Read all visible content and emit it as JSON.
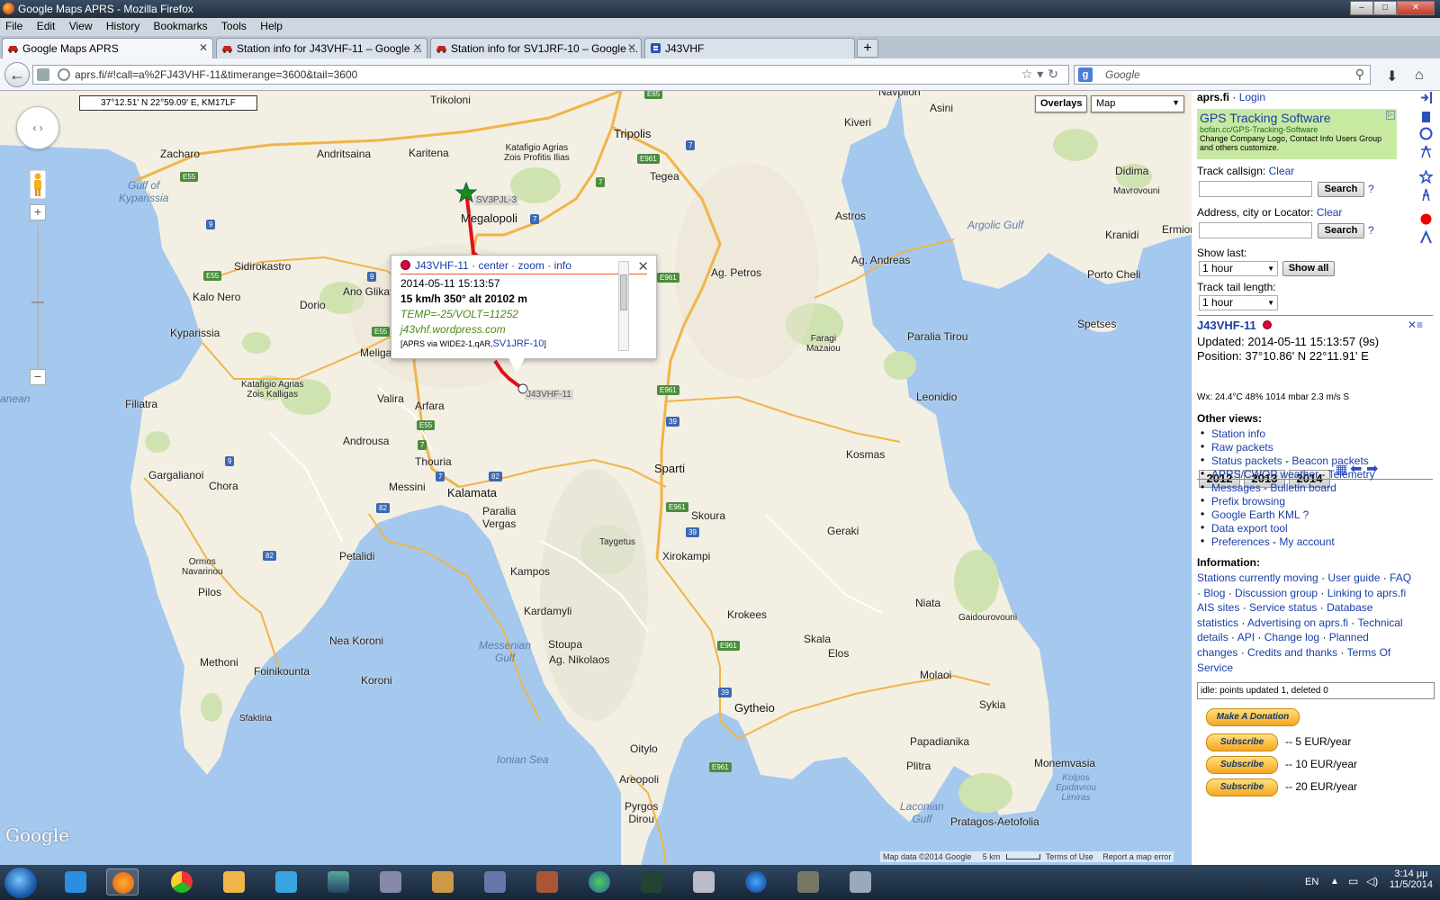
{
  "window": {
    "title": "Google Maps APRS - Mozilla Firefox",
    "buttons": {
      "minimize": "–",
      "maximize": "□",
      "close": "✕"
    }
  },
  "menu": [
    "File",
    "Edit",
    "View",
    "History",
    "Bookmarks",
    "Tools",
    "Help"
  ],
  "tabs": [
    {
      "label": "Google Maps APRS",
      "icon": "car-icon",
      "active": true
    },
    {
      "label": "Station info for J43VHF-11 – Google ...",
      "icon": "car-icon",
      "active": false
    },
    {
      "label": "Station info for SV1JRF-10 – Google ...",
      "icon": "car-icon",
      "active": false
    },
    {
      "label": "J43VHF",
      "icon": "blogger-icon",
      "active": false
    }
  ],
  "nav": {
    "url": "aprs.fi/#!call=a%2FJ43VHF-11&timerange=3600&tail=3600",
    "search_placeholder": "Google"
  },
  "map": {
    "coord_readout": "37°12.51' N 22°59.09' E, KM17LF",
    "overlays_label": "Overlays",
    "maptype_label": "Map",
    "google_logo": "Google",
    "attribution": "Map data ©2014 Google",
    "scale_label": "5 km",
    "terms_label": "Terms of Use",
    "report_label": "Report a map error",
    "zoom_in": "+",
    "zoom_out": "−",
    "labels": {
      "trikoloni": "Trikoloni",
      "tripolis": "Tripolis",
      "kiveri": "Kiveri",
      "astros": "Astros",
      "zacharo": "Zacharo",
      "andritsaina": "Andritsaina",
      "karitena": "Karitena",
      "megalopoli": "Megalopoli",
      "tegea": "Tegea",
      "gulf_kyparissia": "Gulf of\nKyparissia",
      "sidirokastro": "Sidirokastro",
      "kalo_nero": "Kalo Nero",
      "dorio": "Dorio",
      "ano_glikata": "Ano Glikata",
      "kyparissia": "Kyparissia",
      "meligala": "Meligal",
      "ag_petros": "Ag. Petros",
      "ag_andreas": "Ag. Andreas",
      "argolic_gulf": "Argolic Gulf",
      "paralia_tirou": "Paralia Tirou",
      "leonidio": "Leonidio",
      "filiatra": "Filiatra",
      "valira": "Valira",
      "arfara": "Arfara",
      "androusa": "Androusa",
      "thouria": "Thouria",
      "gargalianoi": "Gargalianoi",
      "chora": "Chora",
      "messini": "Messini",
      "kalamata": "Kalamata",
      "paralia_vergas": "Paralia\nVergas",
      "sparti": "Sparti",
      "kosmas": "Kosmas",
      "skoura": "Skoura",
      "geraki": "Geraki",
      "petalidi": "Petalidi",
      "kampos": "Kampos",
      "xirokampi": "Xirokampi",
      "pilos": "Pilos",
      "kardamyli": "Kardamyli",
      "krokees": "Krokees",
      "niata": "Niata",
      "nea_koroni": "Nea Koroni",
      "messenian_gulf": "Messenian\nGulf",
      "stoupa": "Stoupa",
      "ag_nikolaos": "Ag. Nikolaos",
      "skala": "Skala",
      "elos": "Elos",
      "methoni": "Methoni",
      "foinikounta": "Foinikounta",
      "koroni": "Koroni",
      "molaoi": "Molaoi",
      "gytheio": "Gytheio",
      "sykia": "Sykia",
      "oitylo": "Oitylo",
      "areopoli": "Areopoli",
      "ionian_sea": "Ionian Sea",
      "papadianika": "Papadianika",
      "pyrgos_dirou": "Pyrgos\nDirou",
      "monemvasia": "Monemvasia",
      "laconian_gulf": "Laconian\nGulf",
      "plitra": "Plitra",
      "pratagos": "Pratagos-Aetofolia",
      "kolpos": "Kolpos\nEpidavrou\nLimiras",
      "navplion": "Navplion",
      "asini": "Asini",
      "didima": "Didima",
      "kranidi": "Kranidi",
      "ermioni": "Ermion",
      "porto_cheli": "Porto Cheli",
      "spetses": "Spetses",
      "mavrovouni": "Mavrovouni",
      "faragi": "Faragi\nMazaiou",
      "taygetus": "Taygetus",
      "gaidourovouni": "Gaidourovouni",
      "ormos": "Ormos\nNavarinou",
      "sfaktiria": "Sfaktiria",
      "katafigio_zois": "Katafigio Agrias\nZois Profitis Ilias",
      "katafigio_kalligas": "Katafigio Agrias\nZois Kalligas",
      "anean": "anean",
      "e65": "E65",
      "e55": "E55",
      "e961": "E961",
      "n7": "7",
      "n9": "9",
      "n82": "82",
      "n39": "39"
    },
    "stations": {
      "sv3pjl": "SV3PJL-3",
      "j43vhf": "J43VHF-11"
    },
    "track_color": "#e0101a"
  },
  "popup": {
    "callsign": "J43VHF-11",
    "center": "center",
    "zoom": "zoom",
    "info": "info",
    "dot": "·",
    "timestamp": "2014-05-11 15:13:57",
    "motion": "15 km/h 350° alt 20102 m",
    "comment": "TEMP=-25/VOLT=11252",
    "website": "j43vhf.wordpress.com",
    "path_prefix": "[APRS via WIDE2-1,qAR,",
    "path_igate": "SV1JRF-10",
    "path_suffix": "]",
    "close": "✕"
  },
  "side": {
    "site": "aprs.fi",
    "login": "Login",
    "ad_title": "GPS Tracking Software",
    "ad_url": "bofan.cc/GPS-Tracking-Software",
    "ad_text": "Change Company Logo, Contact Info Users Group and others customize.",
    "track_label": "Track callsign:",
    "clear": "Clear",
    "search": "Search",
    "help": "?",
    "address_label": "Address, city or Locator:",
    "show_last_label": "Show last:",
    "show_last_value": "1 hour",
    "show_all": "Show all",
    "tail_label": "Track tail length:",
    "tail_value": "1 hour",
    "station": "J43VHF-11",
    "updated": "Updated: 2014-05-11 15:13:57 (9s)",
    "position": "Position: 37°10.86' N 22°11.91' E",
    "years": [
      "2012",
      "2013",
      "2014"
    ],
    "weather": "Wx: 24.4°C 48% 1014 mbar 2.3 m/s S",
    "other_views_title": "Other views:",
    "other_views": [
      [
        "Station info"
      ],
      [
        "Raw packets"
      ],
      [
        "Status packets",
        "Beacon packets"
      ],
      [
        "APRS/CWOP weather",
        "Telemetry"
      ],
      [
        "Messages",
        "Bulletin board"
      ],
      [
        "Prefix browsing"
      ],
      [
        "Google Earth KML ?"
      ],
      [
        "Data export tool"
      ],
      [
        "Preferences",
        "My account"
      ]
    ],
    "info_title": "Information:",
    "info_lines": [
      [
        "Stations currently moving",
        "User guide",
        "FAQ"
      ],
      [
        "Blog",
        "Discussion group",
        "Linking to aprs.fi"
      ],
      [
        "AIS sites",
        "Service status",
        "Database"
      ],
      [
        "statistics",
        "Advertising on aprs.fi",
        "Technical"
      ],
      [
        "details",
        "API",
        "Change log",
        "Planned"
      ],
      [
        "changes",
        "Credits and thanks",
        "Terms Of"
      ],
      [
        "Service"
      ]
    ],
    "idle": "idle: points updated 1, deleted 0",
    "donate": "Make A Donation",
    "subscribe": "Subscribe",
    "sub_5": "-- 5 EUR/year",
    "sub_10": "-- 10 EUR/year",
    "sub_20": "-- 20 EUR/year"
  },
  "taskbar": {
    "lang": "EN",
    "time": "3:14 μμ",
    "date": "11/5/2014"
  }
}
